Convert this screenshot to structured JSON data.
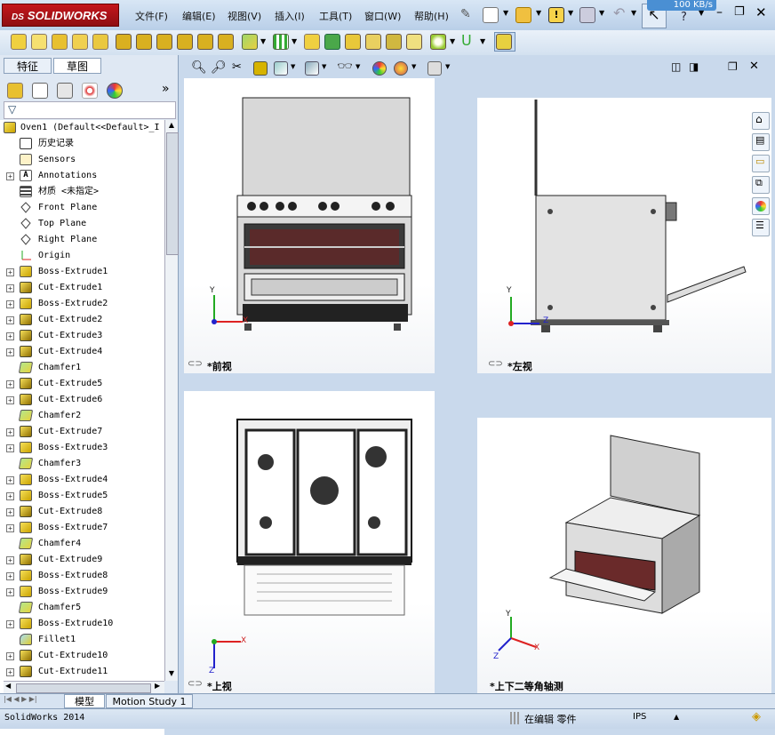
{
  "app": {
    "logo_text": "SOLIDWORKS",
    "logo_prefix": "DS",
    "speed_badge": "100 KB/s"
  },
  "menu": [
    "文件(F)",
    "编辑(E)",
    "视图(V)",
    "插入(I)",
    "工具(T)",
    "窗口(W)",
    "帮助(H)"
  ],
  "panel": {
    "tab_feature": "特征",
    "tab_sketch": "草图",
    "more": "»"
  },
  "tree": {
    "root": "Oven1  (Default<<Default>_I",
    "items": [
      {
        "label": "历史记录",
        "type": "history",
        "expand": false
      },
      {
        "label": "Sensors",
        "type": "sensor",
        "expand": false
      },
      {
        "label": "Annotations",
        "type": "annot",
        "expand": true
      },
      {
        "label": "材质 <未指定>",
        "type": "material",
        "expand": false
      },
      {
        "label": "Front Plane",
        "type": "plane",
        "expand": false
      },
      {
        "label": "Top Plane",
        "type": "plane",
        "expand": false
      },
      {
        "label": "Right Plane",
        "type": "plane",
        "expand": false
      },
      {
        "label": "Origin",
        "type": "origin",
        "expand": false
      },
      {
        "label": "Boss-Extrude1",
        "type": "boss",
        "expand": true
      },
      {
        "label": "Cut-Extrude1",
        "type": "cut",
        "expand": true
      },
      {
        "label": "Boss-Extrude2",
        "type": "boss",
        "expand": true
      },
      {
        "label": "Cut-Extrude2",
        "type": "cut",
        "expand": true
      },
      {
        "label": "Cut-Extrude3",
        "type": "cut",
        "expand": true
      },
      {
        "label": "Cut-Extrude4",
        "type": "cut",
        "expand": true
      },
      {
        "label": "Chamfer1",
        "type": "chamfer",
        "expand": false
      },
      {
        "label": "Cut-Extrude5",
        "type": "cut",
        "expand": true
      },
      {
        "label": "Cut-Extrude6",
        "type": "cut",
        "expand": true
      },
      {
        "label": "Chamfer2",
        "type": "chamfer",
        "expand": false
      },
      {
        "label": "Cut-Extrude7",
        "type": "cut",
        "expand": true
      },
      {
        "label": "Boss-Extrude3",
        "type": "boss",
        "expand": true
      },
      {
        "label": "Chamfer3",
        "type": "chamfer",
        "expand": false
      },
      {
        "label": "Boss-Extrude4",
        "type": "boss",
        "expand": true
      },
      {
        "label": "Boss-Extrude5",
        "type": "boss",
        "expand": true
      },
      {
        "label": "Cut-Extrude8",
        "type": "cut",
        "expand": true
      },
      {
        "label": "Boss-Extrude7",
        "type": "boss",
        "expand": true
      },
      {
        "label": "Chamfer4",
        "type": "chamfer",
        "expand": false
      },
      {
        "label": "Cut-Extrude9",
        "type": "cut",
        "expand": true
      },
      {
        "label": "Boss-Extrude8",
        "type": "boss",
        "expand": true
      },
      {
        "label": "Boss-Extrude9",
        "type": "boss",
        "expand": true
      },
      {
        "label": "Chamfer5",
        "type": "chamfer",
        "expand": false
      },
      {
        "label": "Boss-Extrude10",
        "type": "boss",
        "expand": true
      },
      {
        "label": "Fillet1",
        "type": "fillet",
        "expand": false
      },
      {
        "label": "Cut-Extrude10",
        "type": "cut",
        "expand": true
      },
      {
        "label": "Cut-Extrude11",
        "type": "cut",
        "expand": true
      }
    ]
  },
  "viewports": {
    "front": "*前视",
    "left": "*左视",
    "top": "*上视",
    "iso": "*上下二等角轴测"
  },
  "axis": {
    "x": "X",
    "y": "Y",
    "z": "Z"
  },
  "bottom_tabs": {
    "model": "模型",
    "motion": "Motion Study 1"
  },
  "status": {
    "version": "SolidWorks 2014",
    "editing": "在编辑 零件",
    "units": "IPS"
  },
  "colors": {
    "accent": "#c4161c",
    "panel_bg": "#dfe8f3",
    "frame": "#c9d9ec"
  }
}
